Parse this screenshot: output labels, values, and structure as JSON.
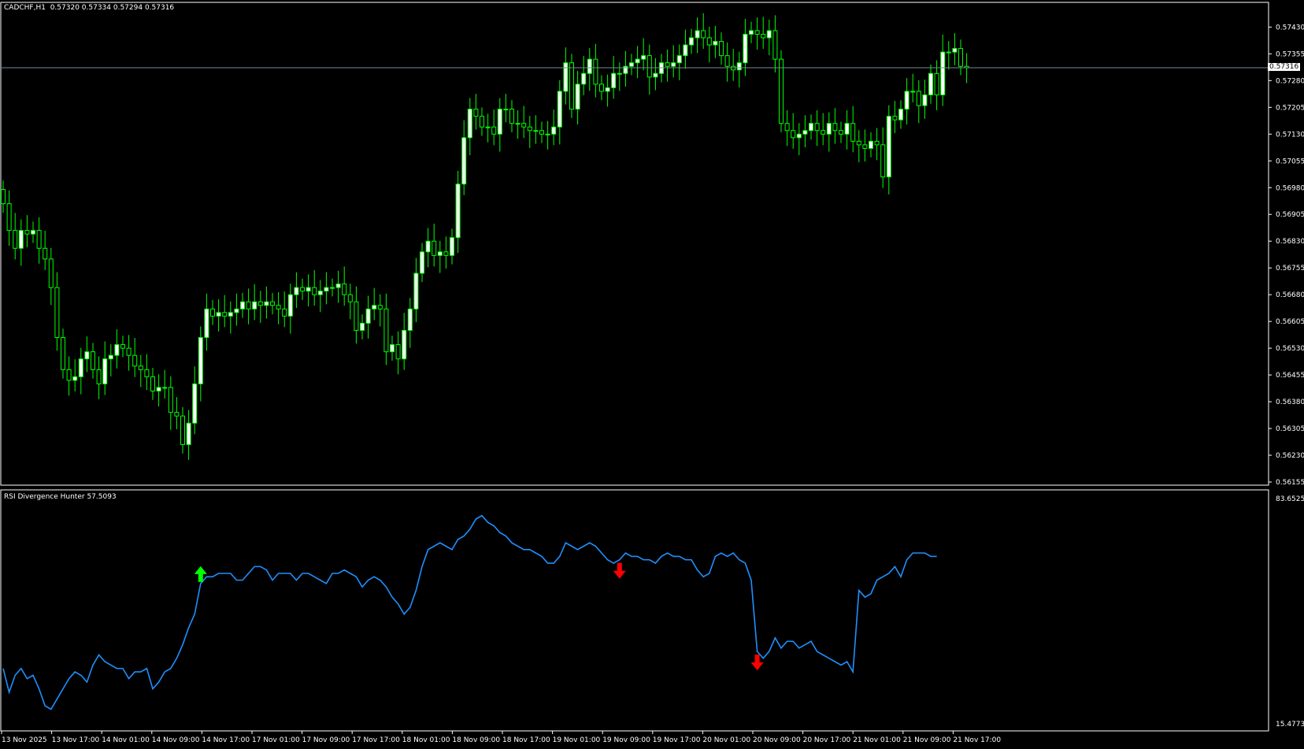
{
  "main_header": {
    "symbol": "CADCHF,H1",
    "ohlc": "0.57320 0.57334 0.57294 0.57316"
  },
  "indicator_header": {
    "name": "RSI Divergence Hunter",
    "value": "57.5093"
  },
  "current_price_label": "0.57316",
  "colors": {
    "background": "#000000",
    "bull_candle": "#ffffff",
    "bear_candle": "#000000",
    "wick": "#00ff00",
    "rsi_line": "#1e90ff",
    "bid_line": "#778899",
    "buy_arrow": "#00ff00",
    "sell_arrow": "#ff0000",
    "axis": "#ffffff"
  },
  "chart_data": [
    {
      "type": "candlestick",
      "title": "CADCHF,H1",
      "ylim": [
        0.56155,
        0.57475
      ],
      "y_ticks": [
        "0.57430",
        "0.57355",
        "0.57280",
        "0.57205",
        "0.57130",
        "0.57055",
        "0.56980",
        "0.56905",
        "0.56830",
        "0.56755",
        "0.56680",
        "0.56605",
        "0.56530",
        "0.56455",
        "0.56380",
        "0.56305",
        "0.56230",
        "0.56155"
      ],
      "current_price": 0.57316,
      "closes": [
        0.56935,
        0.5686,
        0.5681,
        0.5686,
        0.5685,
        0.5686,
        0.5681,
        0.5678,
        0.567,
        0.5656,
        0.5647,
        0.5644,
        0.5645,
        0.565,
        0.5652,
        0.5647,
        0.5643,
        0.565,
        0.5651,
        0.5654,
        0.5653,
        0.5651,
        0.5648,
        0.5647,
        0.5645,
        0.5641,
        0.5642,
        0.5642,
        0.5635,
        0.5634,
        0.5626,
        0.5632,
        0.5643,
        0.5656,
        0.5664,
        0.5662,
        0.5663,
        0.5662,
        0.5663,
        0.5664,
        0.5666,
        0.5664,
        0.5666,
        0.5665,
        0.5666,
        0.5665,
        0.5664,
        0.5662,
        0.5668,
        0.567,
        0.5669,
        0.567,
        0.5668,
        0.5669,
        0.567,
        0.567,
        0.5671,
        0.5668,
        0.5666,
        0.5658,
        0.566,
        0.5664,
        0.5665,
        0.5664,
        0.5652,
        0.5654,
        0.565,
        0.5658,
        0.5664,
        0.5674,
        0.568,
        0.5683,
        0.5679,
        0.568,
        0.5679,
        0.5684,
        0.5699,
        0.5712,
        0.572,
        0.5718,
        0.5715,
        0.5715,
        0.5713,
        0.572,
        0.572,
        0.5716,
        0.5716,
        0.5715,
        0.5714,
        0.5714,
        0.5713,
        0.5713,
        0.5715,
        0.5725,
        0.5733,
        0.572,
        0.5727,
        0.573,
        0.5734,
        0.5727,
        0.5725,
        0.5726,
        0.573,
        0.573,
        0.5732,
        0.5733,
        0.5734,
        0.5735,
        0.5729,
        0.573,
        0.5733,
        0.5732,
        0.5733,
        0.5735,
        0.5738,
        0.574,
        0.5742,
        0.574,
        0.5738,
        0.5739,
        0.5735,
        0.5732,
        0.5731,
        0.5733,
        0.5741,
        0.5742,
        0.5741,
        0.574,
        0.5742,
        0.5734,
        0.5716,
        0.5714,
        0.5712,
        0.5713,
        0.5714,
        0.5716,
        0.5714,
        0.5713,
        0.5716,
        0.5714,
        0.5713,
        0.5716,
        0.5711,
        0.571,
        0.5709,
        0.5711,
        0.571,
        0.5701,
        0.5718,
        0.5717,
        0.572,
        0.5725,
        0.5725,
        0.5721,
        0.5724,
        0.573,
        0.5724,
        0.5736,
        0.5736,
        0.5737,
        0.5732,
        0.57316
      ],
      "xlabel": "",
      "ylabel": ""
    },
    {
      "type": "line",
      "title": "RSI Divergence Hunter 57.5093",
      "ylim": [
        15.4773,
        83.6525
      ],
      "y_ticks": [
        "83.6525",
        "15.4773"
      ],
      "series": [
        {
          "values": [
            32,
            25,
            30,
            32,
            29,
            30,
            26,
            21,
            20,
            23,
            26,
            29,
            31,
            30,
            28,
            33,
            36,
            34,
            33,
            32,
            32,
            29,
            31,
            31,
            32,
            26,
            28,
            31,
            32,
            35,
            39,
            44,
            48,
            57,
            59,
            59,
            60,
            60,
            60,
            58,
            58,
            60,
            62,
            62,
            61,
            58,
            60,
            60,
            60,
            58,
            60,
            60,
            59,
            58,
            57,
            60,
            60,
            61,
            60,
            59,
            56,
            58,
            59,
            58,
            56,
            53,
            51,
            48,
            50,
            55,
            62,
            67,
            68,
            69,
            68,
            67,
            70,
            71,
            73,
            76,
            77,
            75,
            74,
            72,
            71,
            69,
            68,
            67,
            67,
            66,
            65,
            63,
            63,
            65,
            69,
            68,
            67,
            68,
            69,
            68,
            66,
            64,
            63,
            64,
            66,
            65,
            65,
            64,
            64,
            63,
            65,
            66,
            65,
            65,
            64,
            64,
            61,
            59,
            60,
            65,
            66,
            65,
            66,
            64,
            63,
            58,
            37,
            35,
            37,
            41,
            38,
            40,
            40,
            38,
            39,
            40,
            37,
            36,
            35,
            34,
            33,
            34,
            31,
            55,
            53,
            54,
            58,
            59,
            60,
            62,
            59,
            64,
            66,
            66,
            66,
            65,
            65
          ]
        }
      ],
      "arrows": [
        {
          "type": "buy",
          "index": 33
        },
        {
          "type": "sell",
          "index": 103
        },
        {
          "type": "sell",
          "index": 126
        }
      ]
    }
  ],
  "x_axis_labels": [
    "13 Nov 2025",
    "13 Nov 17:00",
    "14 Nov 01:00",
    "14 Nov 09:00",
    "14 Nov 17:00",
    "17 Nov 01:00",
    "17 Nov 09:00",
    "17 Nov 17:00",
    "18 Nov 01:00",
    "18 Nov 09:00",
    "18 Nov 17:00",
    "19 Nov 01:00",
    "19 Nov 09:00",
    "19 Nov 17:00",
    "20 Nov 01:00",
    "20 Nov 09:00",
    "20 Nov 17:00",
    "21 Nov 01:00",
    "21 Nov 09:00",
    "21 Nov 17:00"
  ]
}
